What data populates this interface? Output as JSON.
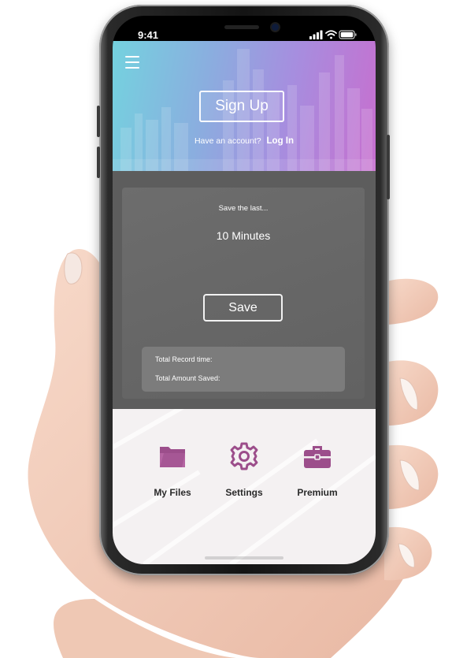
{
  "status_bar": {
    "time": "9:41",
    "icons": [
      "signal-icon",
      "wifi-icon",
      "battery-icon"
    ]
  },
  "header": {
    "menu_icon": "hamburger-menu-icon",
    "signup_label": "Sign Up",
    "account_prompt": "Have an account?",
    "login_label": "Log In"
  },
  "recorder": {
    "save_label_prompt": "Save the last...",
    "duration": "10 Minutes",
    "save_button": "Save",
    "total_record_time_label": "Total Record time:",
    "total_amount_saved_label": "Total Amount Saved:"
  },
  "nav": {
    "items": [
      {
        "label": "My Files",
        "icon": "folder-icon"
      },
      {
        "label": "Settings",
        "icon": "gear-icon"
      },
      {
        "label": "Premium",
        "icon": "briefcase-icon"
      }
    ]
  },
  "colors": {
    "accent": "#9c4e8b",
    "header_gradient_start": "#74d2df",
    "header_gradient_end": "#c76fcf",
    "panel_bg": "#5d5d5d",
    "nav_bg": "#f4f1f2"
  }
}
